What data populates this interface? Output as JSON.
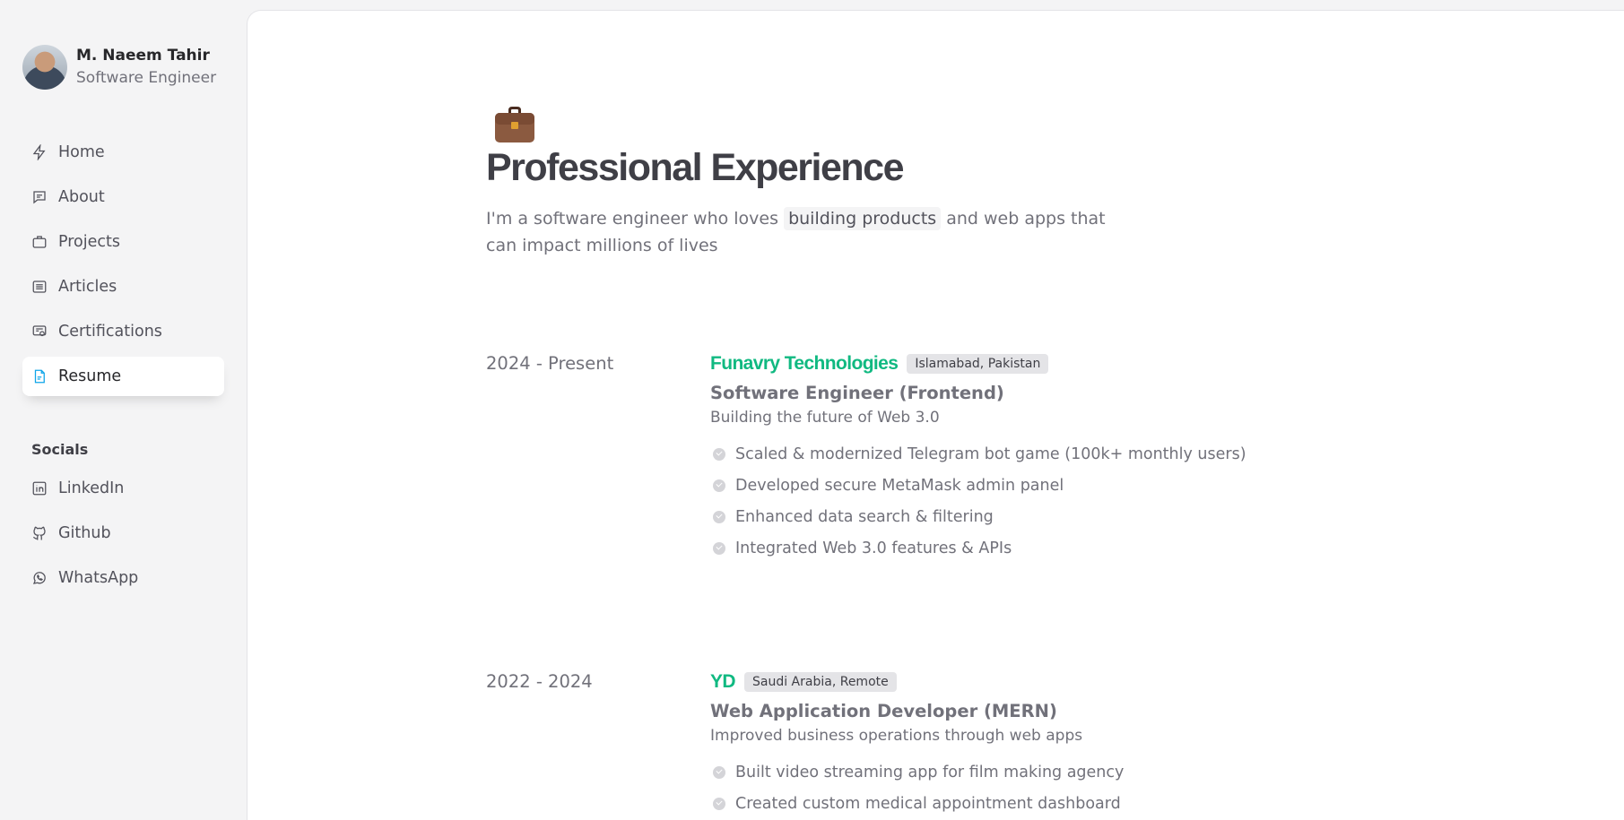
{
  "profile": {
    "name": "M. Naeem Tahir",
    "role": "Software Engineer"
  },
  "nav": [
    {
      "label": "Home",
      "icon": "bolt-icon",
      "active": false
    },
    {
      "label": "About",
      "icon": "chat-icon",
      "active": false
    },
    {
      "label": "Projects",
      "icon": "briefcase-icon",
      "active": false
    },
    {
      "label": "Articles",
      "icon": "document-list-icon",
      "active": false
    },
    {
      "label": "Certifications",
      "icon": "certificate-icon",
      "active": false
    },
    {
      "label": "Resume",
      "icon": "resume-file-icon",
      "active": true
    }
  ],
  "socials": {
    "title": "Socials",
    "items": [
      {
        "label": "LinkedIn",
        "icon": "linkedin-icon"
      },
      {
        "label": "Github",
        "icon": "github-icon"
      },
      {
        "label": "WhatsApp",
        "icon": "whatsapp-icon"
      }
    ]
  },
  "page": {
    "emoji": "briefcase",
    "title": "Professional Experience",
    "intro_before": "I'm a software engineer who loves",
    "intro_highlight": "building products",
    "intro_after": "and web apps that can impact millions of lives"
  },
  "jobs": [
    {
      "period": "2024 - Present",
      "company": "Funavry Technologies",
      "location": "Islamabad, Pakistan",
      "role": "Software Engineer (Frontend)",
      "tagline": "Building the future of Web 3.0",
      "bullets": [
        "Scaled & modernized Telegram bot game (100k+ monthly users)",
        "Developed secure MetaMask admin panel",
        "Enhanced data search & filtering",
        "Integrated Web 3.0 features & APIs"
      ]
    },
    {
      "period": "2022 - 2024",
      "company": "YD",
      "location": "Saudi Arabia, Remote",
      "role": "Web Application Developer (MERN)",
      "tagline": "Improved business operations through web apps",
      "bullets": [
        "Built video streaming app for film making agency",
        "Created custom medical appointment dashboard"
      ]
    }
  ],
  "colors": {
    "accent_green": "#10b981",
    "active_icon": "#0ea5e9"
  }
}
